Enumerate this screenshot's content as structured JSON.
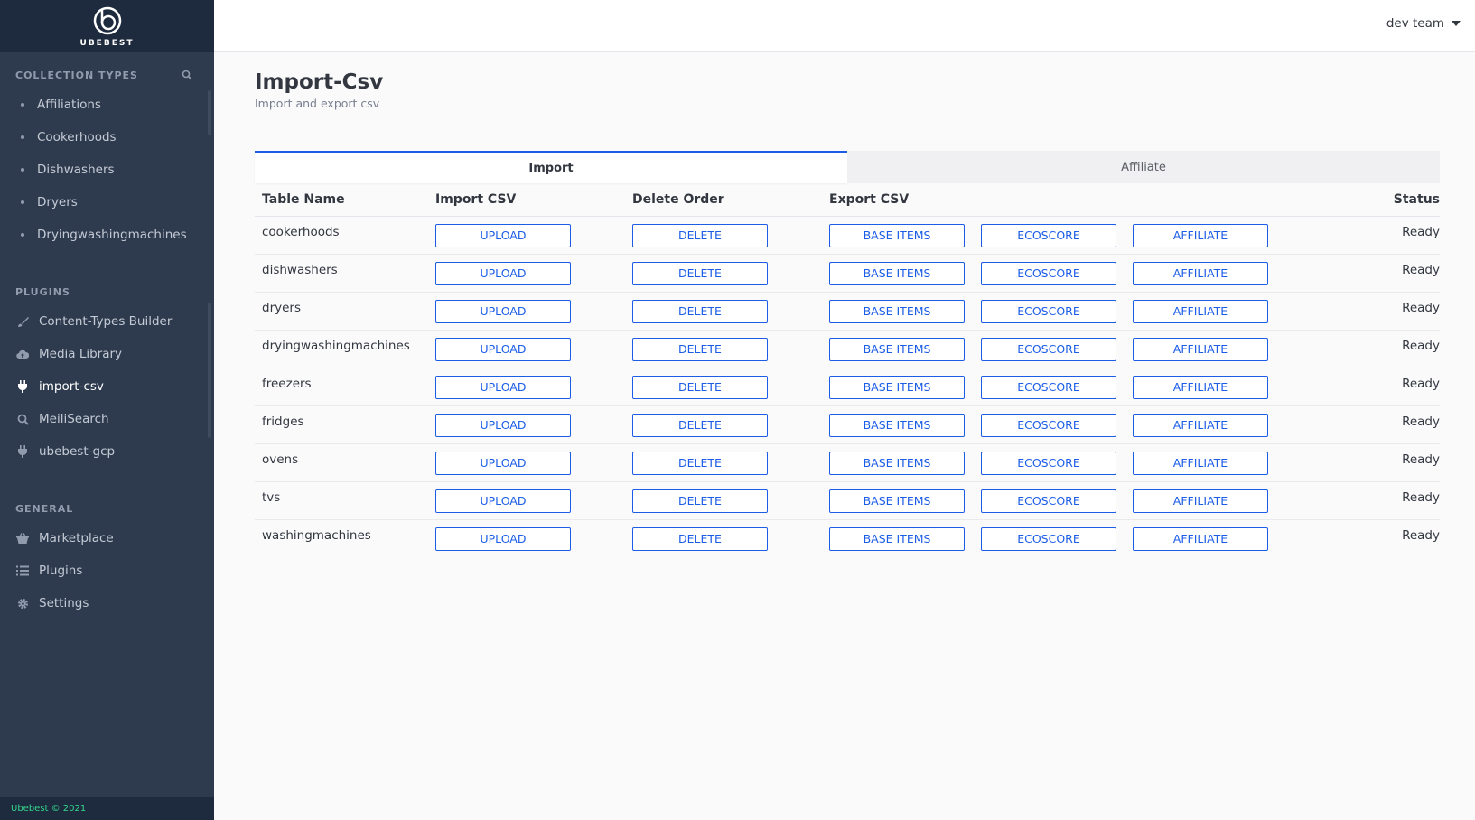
{
  "brand": {
    "name": "UBEBEST"
  },
  "sidebar": {
    "collection_title": "Collection Types",
    "collections": [
      {
        "label": "Affiliations"
      },
      {
        "label": "Cookerhoods"
      },
      {
        "label": "Dishwashers"
      },
      {
        "label": "Dryers"
      },
      {
        "label": "Dryingwashingmachines"
      }
    ],
    "plugins_title": "Plugins",
    "plugins": [
      {
        "label": "Content-Types Builder",
        "icon": "brush-icon"
      },
      {
        "label": "Media Library",
        "icon": "cloud-upload-icon"
      },
      {
        "label": "import-csv",
        "icon": "plug-icon",
        "active": true
      },
      {
        "label": "MeiliSearch",
        "icon": "search-icon"
      },
      {
        "label": "ubebest-gcp",
        "icon": "plug-icon"
      }
    ],
    "general_title": "General",
    "general": [
      {
        "label": "Marketplace",
        "icon": "basket-icon"
      },
      {
        "label": "Plugins",
        "icon": "list-icon"
      },
      {
        "label": "Settings",
        "icon": "gear-icon"
      }
    ],
    "footer": "Ubebest © 2021"
  },
  "header": {
    "user": "dev team"
  },
  "page": {
    "title": "Import-Csv",
    "subtitle": "Import and export csv",
    "tabs": [
      {
        "label": "Import",
        "active": true
      },
      {
        "label": "Affiliate",
        "active": false
      }
    ]
  },
  "table": {
    "headers": {
      "name": "Table Name",
      "import": "Import CSV",
      "delete": "Delete Order",
      "export": "Export CSV",
      "status": "Status"
    },
    "buttons": {
      "upload": "UPLOAD",
      "delete": "DELETE",
      "base": "BASE ITEMS",
      "ecoscore": "ECOSCORE",
      "affiliate": "AFFILIATE"
    },
    "rows": [
      {
        "name": "cookerhoods",
        "status": "Ready"
      },
      {
        "name": "dishwashers",
        "status": "Ready"
      },
      {
        "name": "dryers",
        "status": "Ready"
      },
      {
        "name": "dryingwashingmachines",
        "status": "Ready"
      },
      {
        "name": "freezers",
        "status": "Ready"
      },
      {
        "name": "fridges",
        "status": "Ready"
      },
      {
        "name": "ovens",
        "status": "Ready"
      },
      {
        "name": "tvs",
        "status": "Ready"
      },
      {
        "name": "washingmachines",
        "status": "Ready"
      }
    ]
  },
  "colors": {
    "sidebar_bg": "#2e3b4e",
    "brand_bg": "#1e2b3e",
    "accent": "#1c5de7",
    "footer_text": "#33d68b"
  }
}
